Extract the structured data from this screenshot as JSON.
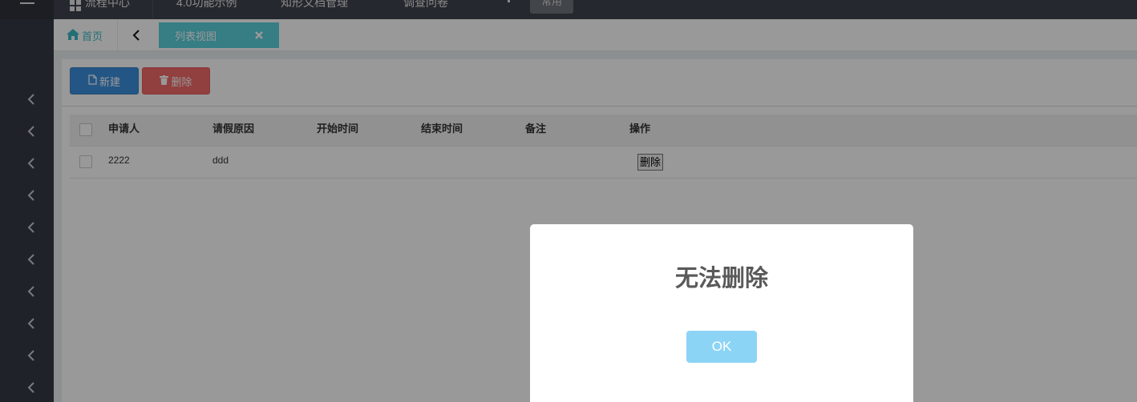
{
  "topnav": {
    "items": [
      "流程中心",
      "4.0功能示例",
      "知形文档管理",
      "调查问卷"
    ],
    "common_button": "常用"
  },
  "tabs": {
    "home_label": "首页",
    "active_label": "列表视图"
  },
  "toolbar": {
    "new_label": "新建",
    "delete_label": "删除"
  },
  "table": {
    "columns": [
      "申请人",
      "请假原因",
      "开始时间",
      "结束时间",
      "备注",
      "操作"
    ],
    "rows": [
      {
        "applicant": "2222",
        "reason": "ddd",
        "start": "",
        "end": "",
        "note": "",
        "action": "删除"
      }
    ]
  },
  "dialog": {
    "title": "无法删除",
    "ok_label": "OK"
  },
  "colors": {
    "sidebar": "#353a45",
    "topnav": "#3e434e",
    "accent": "#5bd0dc",
    "primary": "#3c8fde",
    "danger": "#f26a6a",
    "ok_button": "#8cd4f5"
  },
  "icons": {
    "sidebar_toggle": "hamburger-icon",
    "nav_first": "grid-icon",
    "home": "home-icon",
    "tab_prev": "chevron-left-icon",
    "tab_close": "close-icon",
    "new": "file-icon",
    "delete": "trash-icon",
    "sidebar_items": "chevron-left-icon"
  }
}
